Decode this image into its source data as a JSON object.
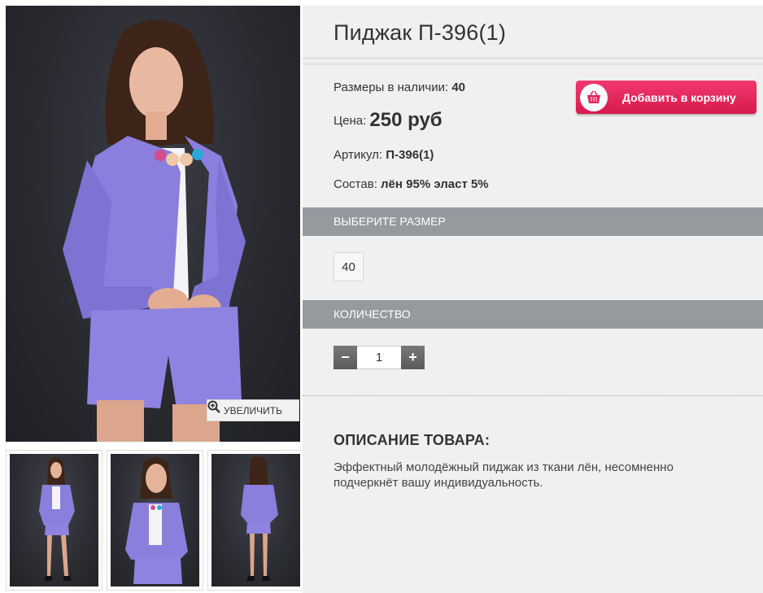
{
  "product": {
    "title": "Пиджак П-396(1)",
    "sizes_label": "Размеры в наличии:",
    "sizes_value": "40",
    "price_label": "Цена:",
    "price_value": "250 руб",
    "article_label": "Артикул:",
    "article_value": "П-396(1)",
    "composition_label": "Состав:",
    "composition_value": "лён 95% эласт 5%"
  },
  "cart": {
    "add_label": "Добавить в корзину",
    "icon": "basket-icon"
  },
  "gallery": {
    "zoom_label": "УВЕЛИЧИТЬ",
    "zoom_icon": "zoom-in-icon"
  },
  "size_section": {
    "heading": "ВЫБЕРИТЕ РАЗМЕР",
    "options": [
      "40"
    ]
  },
  "quantity_section": {
    "heading": "КОЛИЧЕСТВО",
    "minus": "−",
    "plus": "+",
    "value": "1"
  },
  "description": {
    "heading": "ОПИСАНИЕ ТОВАРА:",
    "text": "Эффектный молодёжный пиджак из ткани лён, несомненно подчеркнёт вашу индивидуальность."
  },
  "colors": {
    "cart_button": "#e0245a",
    "section_header": "#959a9f",
    "suit": "#8a7fdc"
  }
}
